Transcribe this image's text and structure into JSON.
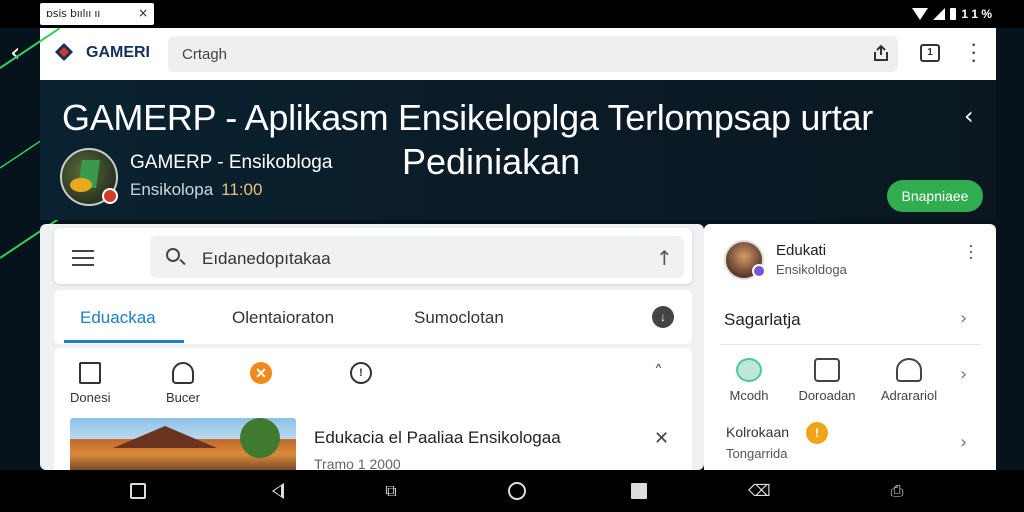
{
  "status_bar": {
    "tab_text": "ɒsis  bıılıı ıı",
    "tab_close": "×",
    "battery_text": "1 1 %"
  },
  "browser": {
    "logo_text": "GAMERI",
    "url_text": "Crtagh",
    "tabs_count": "1"
  },
  "hero": {
    "title_line1": "GAMERP - Aplikasm Ensikeloplga Terlompsap urtar",
    "title_line2": "Pediniakan",
    "app_name": "GAMERP - Ensikobloga",
    "app_sub": "Ensikolopa",
    "app_sub_num": "11:00",
    "action_button": "Bnapniaee"
  },
  "main": {
    "search_text": "Eıdanedopıtakaa",
    "tabs": [
      {
        "label": "Eduackaa"
      },
      {
        "label": "Olentaioraton"
      },
      {
        "label": "Sumoclotan"
      }
    ],
    "categories": [
      {
        "label": "Donesi",
        "icon": "folder-icon"
      },
      {
        "label": "Bucer",
        "icon": "recycle-icon"
      },
      {
        "label": "",
        "icon": "orange-badge-icon",
        "glyph": "✕"
      },
      {
        "label": "",
        "icon": "clock-icon",
        "glyph": "!"
      }
    ],
    "article": {
      "title": "Edukacia el Paaliaa  Ensikologaa",
      "date": "Tramo  1 2000"
    }
  },
  "side_panel": {
    "name": "Edukati",
    "sub": "Ensikoldoga",
    "section_title": "Sagarlatja",
    "items": [
      {
        "label": "Mcodh",
        "icon": "green-circle-icon"
      },
      {
        "label": "Doroadan",
        "icon": "image-icon"
      },
      {
        "label": "Adrarariol",
        "icon": "person-icon"
      }
    ],
    "row_text": "Kolrokaan",
    "row_sub": "Tongarrida",
    "row_badge": "!"
  },
  "colors": {
    "accent_blue": "#1a7fc4",
    "button_green": "#2fad4f",
    "orange": "#f08a1c",
    "hero_bg": "#0b1c28"
  }
}
